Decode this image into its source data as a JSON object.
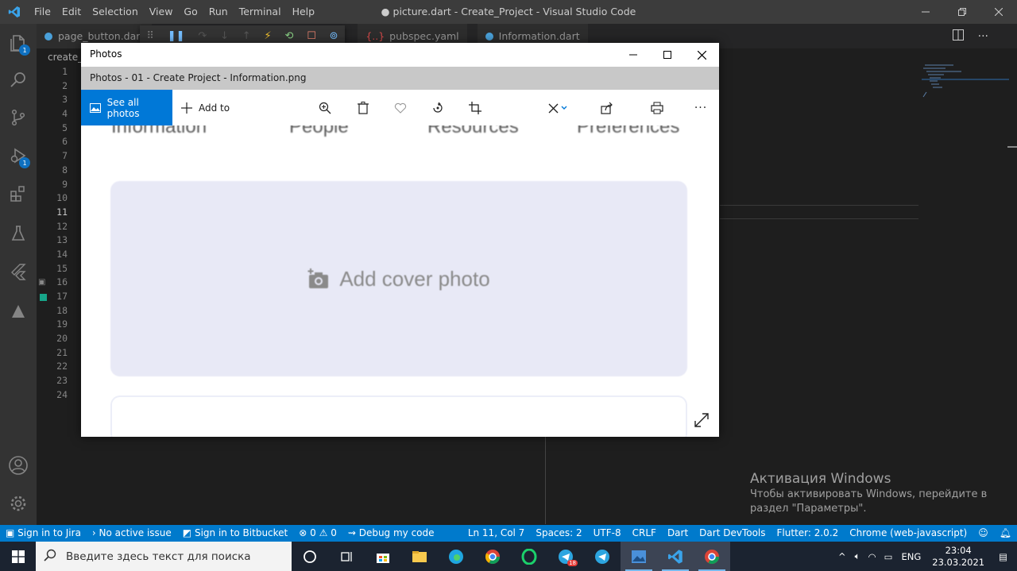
{
  "vscode": {
    "menu": [
      "File",
      "Edit",
      "Selection",
      "View",
      "Go",
      "Run",
      "Terminal",
      "Help"
    ],
    "title": "● picture.dart - Create_Project - Visual Studio Code",
    "tabs": [
      {
        "label": "page_button.dart"
      },
      {
        "label": "pubspec.yaml"
      },
      {
        "label": "Information.dart"
      }
    ],
    "breadcrumb": "create_p",
    "line_numbers": [
      "1",
      "2",
      "3",
      "4",
      "5",
      "6",
      "7",
      "8",
      "9",
      "10",
      "11",
      "12",
      "13",
      "14",
      "15",
      "16",
      "17",
      "18",
      "19",
      "20",
      "21",
      "22",
      "23",
      "24"
    ],
    "active_line": "11",
    "activity_badges": {
      "explorer": "1",
      "debug": "1"
    }
  },
  "activation": {
    "title": "Активация Windows",
    "line1": "Чтобы активировать Windows, перейдите в",
    "line2": "раздел \"Параметры\"."
  },
  "statusbar": {
    "jira": "Sign in to Jira",
    "issue": "No active issue",
    "bitbucket": "Sign in to Bitbucket",
    "errors": "0",
    "warnings": "0",
    "debug": "Debug my code",
    "position": "Ln 11, Col 7",
    "spaces": "Spaces: 2",
    "encoding": "UTF-8",
    "eol": "CRLF",
    "language": "Dart",
    "devtools": "Dart DevTools",
    "flutter": "Flutter: 2.0.2",
    "device": "Chrome (web-javascript)"
  },
  "taskbar": {
    "search_placeholder": "Введите здесь текст для поиска",
    "lang": "ENG",
    "time": "23:04",
    "date": "23.03.2021",
    "telegram_badge": "18"
  },
  "photos": {
    "app_title": "Photos",
    "file_title": "Photos - 01 - Create Project - Information.png",
    "see_all": "See all photos",
    "add_to": "Add to",
    "image": {
      "nav": [
        "Information",
        "People",
        "Resources",
        "Preferences"
      ],
      "cover_text": "Add cover photo"
    }
  },
  "colors": {
    "accent": "#007acc",
    "photos_accent": "#0078d7"
  }
}
